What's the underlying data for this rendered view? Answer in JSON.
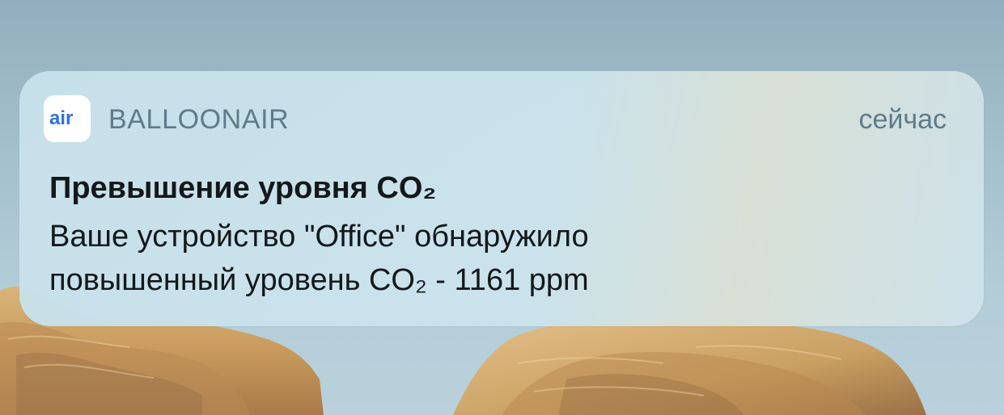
{
  "notification": {
    "app_name": "BALLOONAIR",
    "app_icon": "balloonair-app-icon",
    "timestamp": "сейчас",
    "title": "Превышение уровня CO₂",
    "body_lines": [
      "Ваше устройство \"Office\" обнаружило",
      "повышенный уровень CO₂ - 1161 ppm"
    ],
    "icon_text": "air",
    "accent_color": "#2f6fe0"
  }
}
